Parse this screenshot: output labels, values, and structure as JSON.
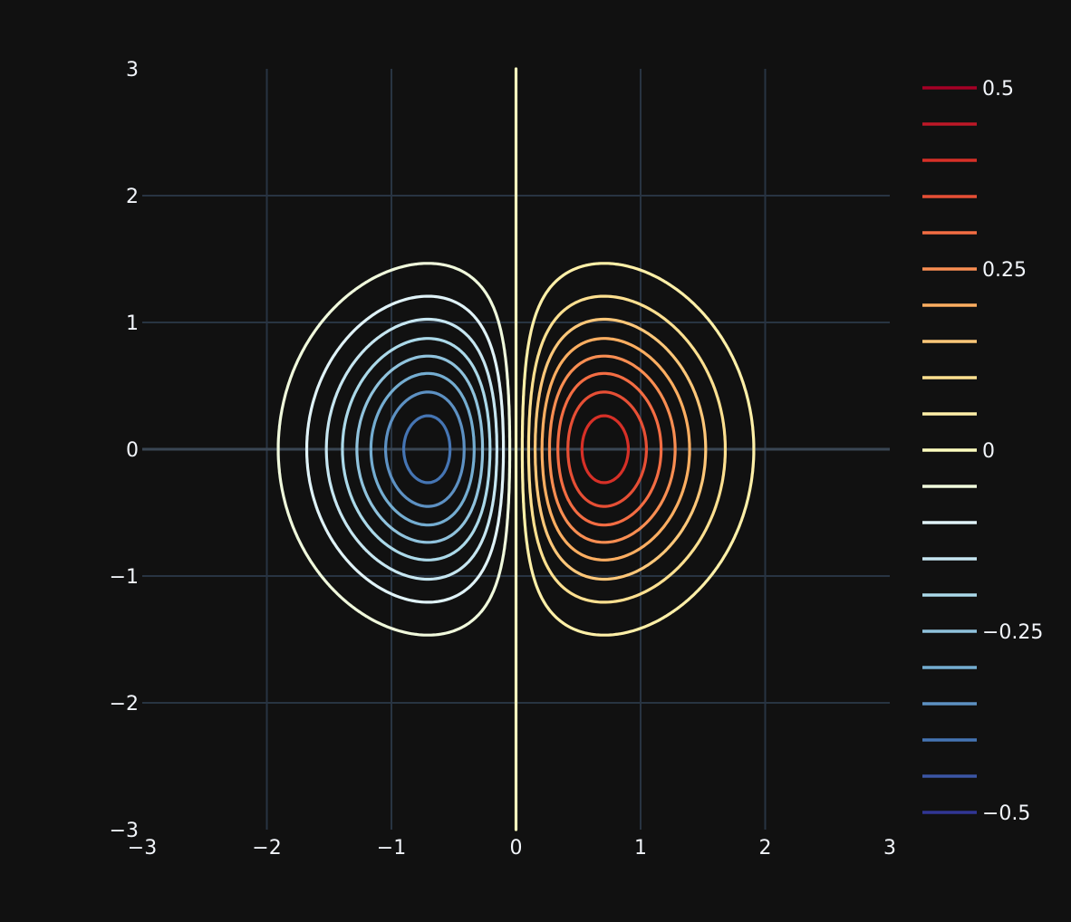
{
  "chart_data": {
    "type": "contour",
    "function": "z = x * exp(-(x^2 + y^2))",
    "x_range": [
      -3,
      3
    ],
    "y_range": [
      -3,
      3
    ],
    "x_ticks": [
      "−3",
      "−2",
      "−1",
      "0",
      "1",
      "2",
      "3"
    ],
    "y_ticks": [
      "3",
      "2",
      "1",
      "0",
      "−1",
      "−2",
      "−3"
    ],
    "contours": {
      "start": -0.45,
      "end": 0.45,
      "size": 0.05,
      "coloring": "lines"
    },
    "colorscale": "RdYlBu (reversed)",
    "colorscale_stops": [
      "#313695",
      "#4575b4",
      "#74add1",
      "#abd9e9",
      "#e0f3f8",
      "#ffffbf",
      "#fee090",
      "#fdae61",
      "#f46d43",
      "#d73027",
      "#a50026"
    ],
    "colorbar": {
      "levels": [
        0.5,
        0.45,
        0.4,
        0.35,
        0.3,
        0.25,
        0.2,
        0.15,
        0.1,
        0.05,
        0,
        -0.05,
        -0.1,
        -0.15,
        -0.2,
        -0.25,
        -0.3,
        -0.35,
        -0.4,
        -0.45,
        -0.5
      ],
      "tick_labels": [
        {
          "value": 0.5,
          "text": "0.5"
        },
        {
          "value": 0.25,
          "text": "0.25"
        },
        {
          "value": 0,
          "text": "0"
        },
        {
          "value": -0.25,
          "text": "−0.25"
        },
        {
          "value": -0.5,
          "text": "−0.5"
        }
      ]
    },
    "grid": true,
    "background": "#111111",
    "grid_color": "#283442",
    "zeroline_color": "#3a4654",
    "title": "",
    "xlabel": "",
    "ylabel": ""
  }
}
